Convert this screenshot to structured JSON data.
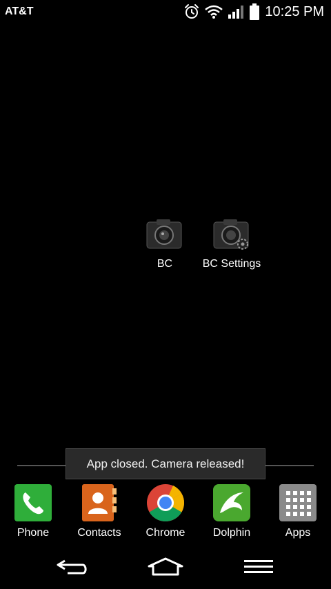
{
  "status_bar": {
    "carrier": "AT&T",
    "time": "10:25 PM",
    "icons": [
      "alarm-icon",
      "wifi-icon",
      "signal-icon",
      "battery-icon"
    ]
  },
  "home": {
    "shortcuts": [
      {
        "label": "BC",
        "icon": "camera-icon"
      },
      {
        "label": "BC Settings",
        "icon": "camera-settings-icon"
      }
    ]
  },
  "toast": {
    "message": "App closed. Camera released!"
  },
  "dock": {
    "items": [
      {
        "label": "Phone",
        "icon": "phone-icon"
      },
      {
        "label": "Contacts",
        "icon": "contacts-icon"
      },
      {
        "label": "Chrome",
        "icon": "chrome-icon"
      },
      {
        "label": "Dolphin",
        "icon": "dolphin-icon"
      },
      {
        "label": "Apps",
        "icon": "apps-grid-icon"
      }
    ]
  },
  "nav": {
    "buttons": [
      "back-icon",
      "home-icon",
      "menu-icon"
    ]
  },
  "colors": {
    "background": "#000000",
    "toast_bg": "#2a2a2a",
    "phone_green": "#2fae3a",
    "contacts_orange": "#d9641c",
    "dolphin_green": "#4aa82f",
    "apps_gray": "#8a8a8a"
  }
}
